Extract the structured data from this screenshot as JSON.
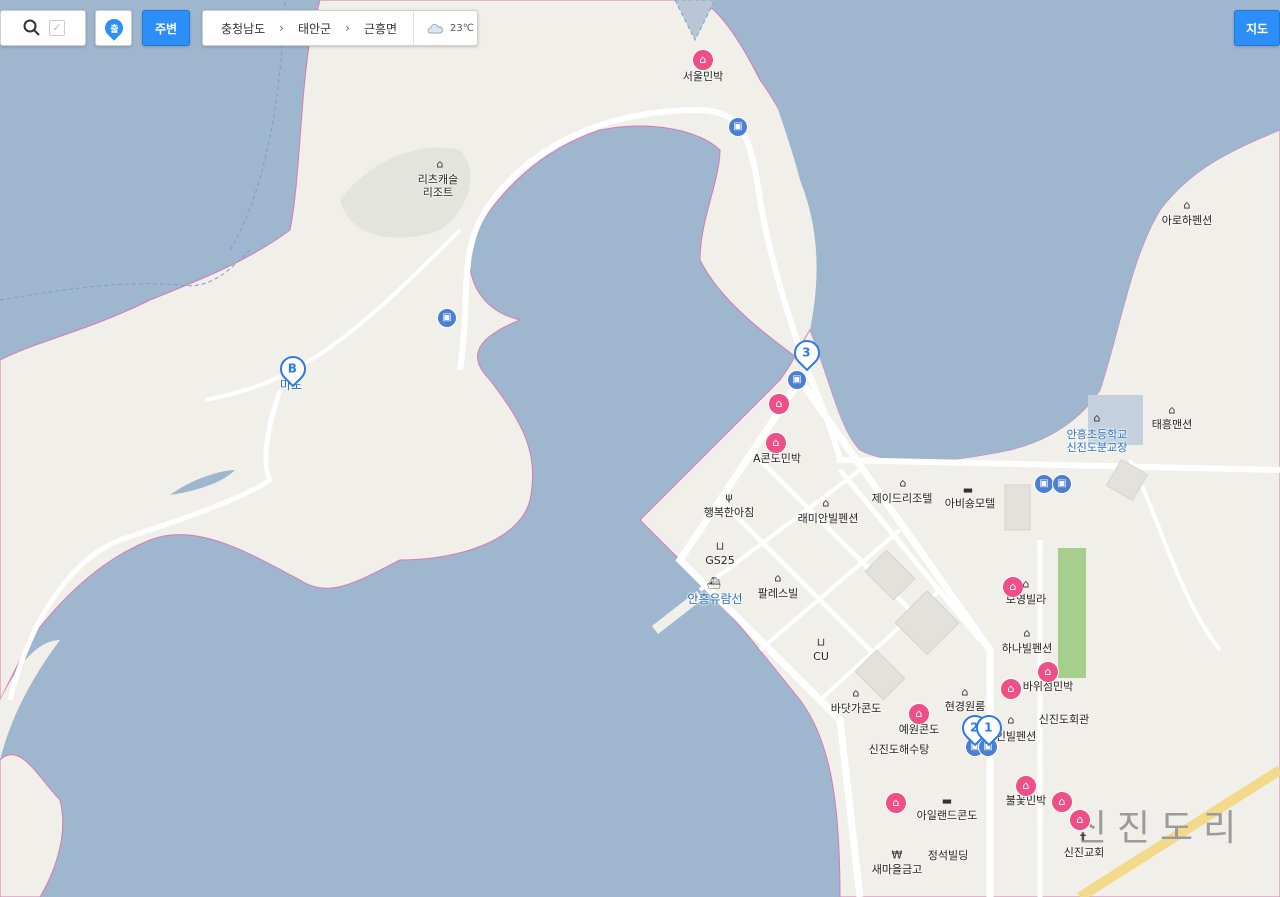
{
  "toolbar": {
    "search_icon": "search-icon",
    "checkbox_icon": "check-icon",
    "location_glyph": "출",
    "nearby_label": "주변",
    "breadcrumbs": [
      "충청남도",
      "태안군",
      "근흥면"
    ],
    "temperature": "23℃",
    "weather_icon": "cloud-icon",
    "map_label": "지도"
  },
  "places": {
    "seoul_minbak": "서울민박",
    "ritz_castle": "리츠캐슬\n리조트",
    "arohi_pension": "아로하펜션",
    "mado": "마도",
    "pin_b": "B",
    "pin_3": "3",
    "pin_2": "2",
    "pin_1": "1",
    "a_condo": "A콘도민박",
    "school": "안흥초등학교\n신진도분교장",
    "taeheung_pension": "태흥맨션",
    "j_resort": "제이드리조텔",
    "abisong_motel": "아비숑모텔",
    "happy_morning": "행복한아침",
    "raemian_pension": "래미안빌펜션",
    "gs25": "GS25",
    "palace_villa": "팔레스빌",
    "anheung_ferry": "안흥유람선",
    "boyoung_villa": "보영빌라",
    "cu": "CU",
    "hana_pension": "하나빌펜션",
    "bawiseom": "바위섬민박",
    "badatga_condo": "바닷가콘도",
    "hyeongyeong": "현경원룸",
    "yewon_condo": "예원콘도",
    "sinjindo_hall": "신진도회관",
    "inbil_pension": "인빌펜션",
    "sinjindo_bath": "신진도해수탕",
    "bulkkot": "불꽃민박",
    "island_condo": "아일랜드콘도",
    "sinjin_church": "신진교회",
    "jeongseok": "정석빌딩",
    "saemaeul": "새마을금고",
    "sinjindo_ri": "신진도리"
  },
  "colors": {
    "water": "#9fb6cf",
    "land": "#f1efe9",
    "coast": "#d87ab5",
    "road": "#ffffff",
    "highway": "#f3d98a",
    "lodging": "#ee4f86",
    "bus": "#4a7fd3",
    "accent": "#2c8ef8"
  }
}
